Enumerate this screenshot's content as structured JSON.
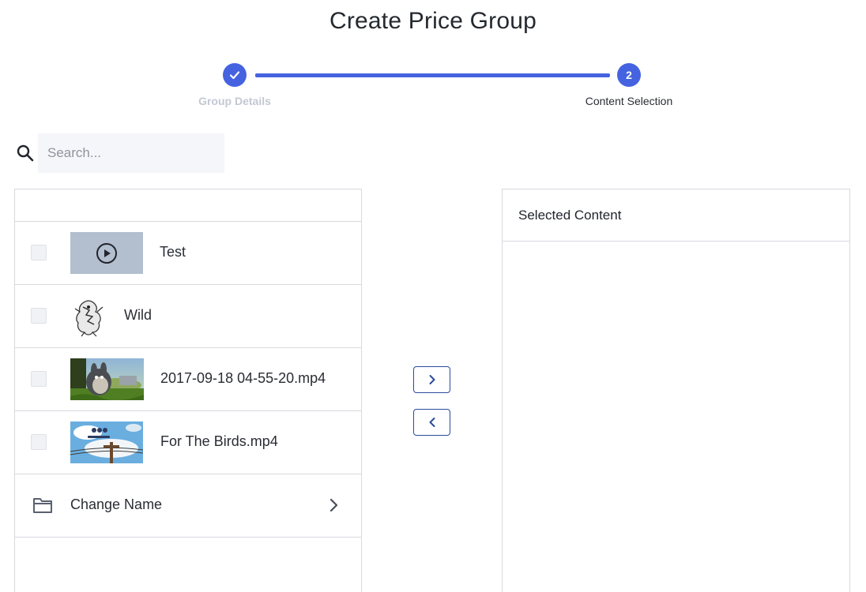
{
  "page": {
    "title": "Create Price Group"
  },
  "stepper": {
    "steps": [
      {
        "label": "Group Details",
        "state": "completed",
        "icon": "check-icon"
      },
      {
        "label": "Content Selection",
        "number": "2",
        "state": "active"
      }
    ],
    "accent_color": "#4563e0",
    "completed_label_color": "#c3c8d3"
  },
  "search": {
    "placeholder": "Search...",
    "value": "",
    "icon": "search-icon"
  },
  "content_list": {
    "items": [
      {
        "label": "Test",
        "thumbnail": "play-placeholder",
        "checked": false
      },
      {
        "label": "Wild",
        "thumbnail": "dragon-sketch-image",
        "checked": false
      },
      {
        "label": "2017-09-18 04-55-20.mp4",
        "thumbnail": "animated-bunny-image",
        "checked": false
      },
      {
        "label": "For The Birds.mp4",
        "thumbnail": "for-the-birds-image",
        "checked": false
      }
    ],
    "folders": [
      {
        "label": "Change Name",
        "icon": "folder-icon",
        "chevron": "chevron-right-icon"
      }
    ]
  },
  "transfer": {
    "add_icon": "chevron-right-icon",
    "remove_icon": "chevron-left-icon"
  },
  "selected_panel": {
    "header": "Selected Content",
    "items": []
  }
}
